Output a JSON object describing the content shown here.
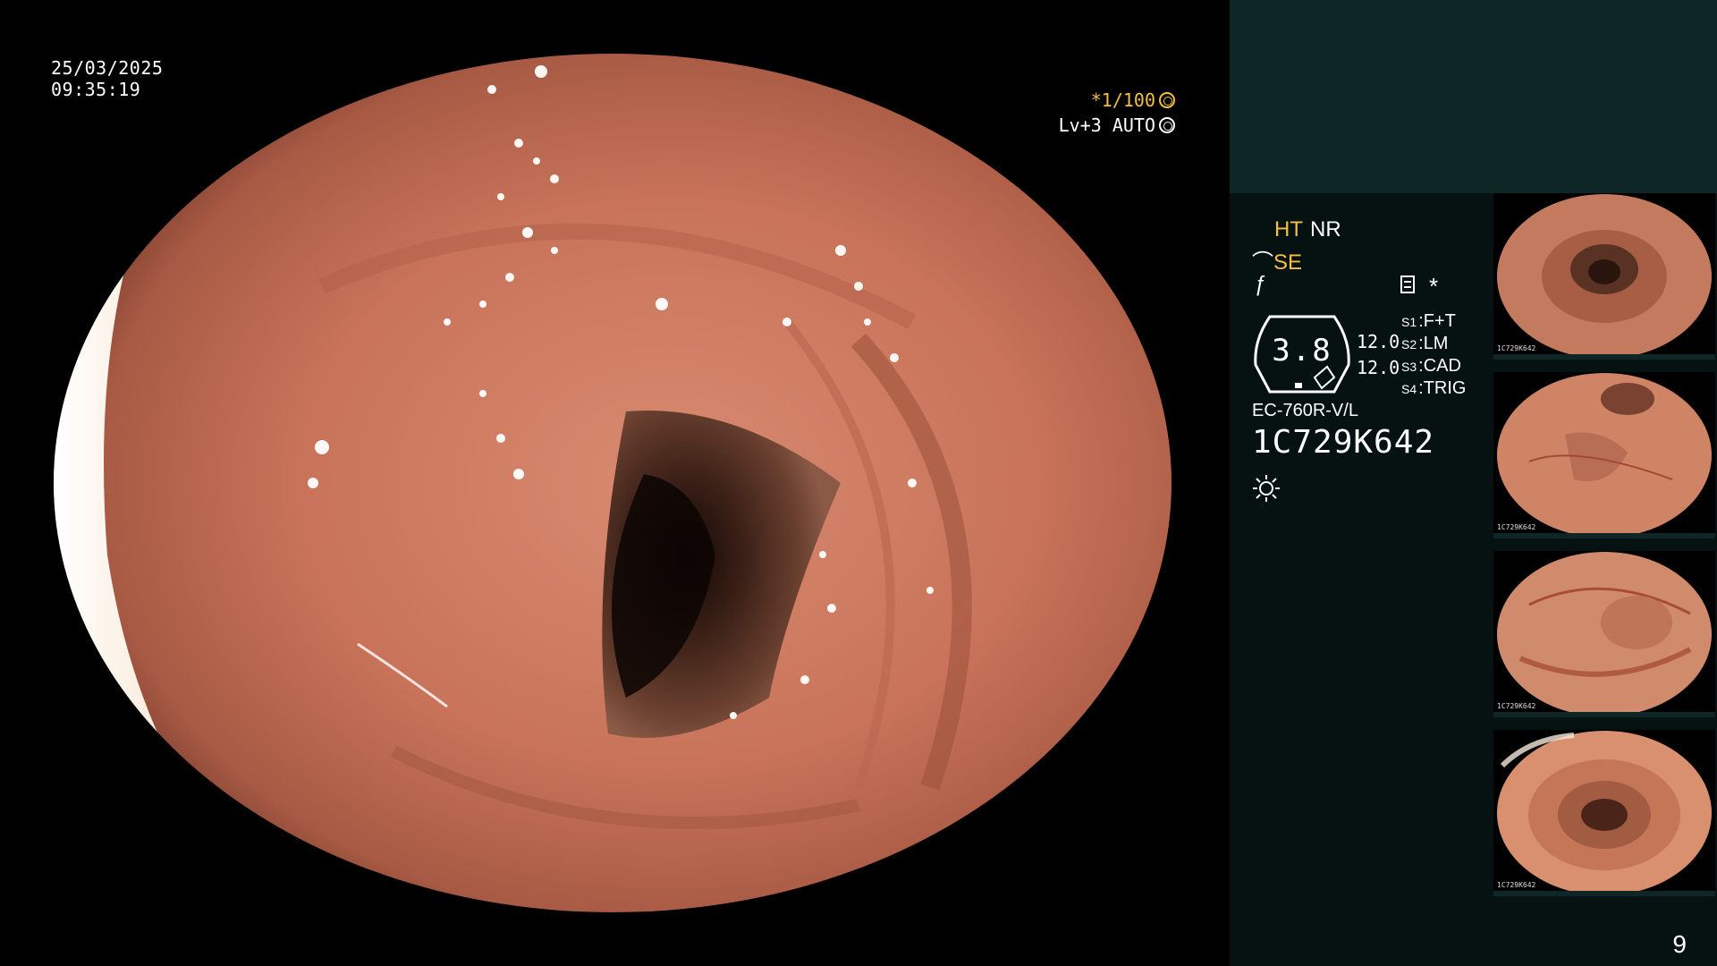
{
  "overlay": {
    "date": "25/03/2025",
    "time": "09:35:19",
    "shutter": "*1/100",
    "level": "Lv+3 AUTO"
  },
  "panel": {
    "ht_label": "HT",
    "nr_label": "NR",
    "se_label": "SE",
    "gauge_value": "3.8",
    "value_1": "12.0",
    "value_2": "12.0",
    "switches": [
      {
        "key": "S1",
        "value": "F+T"
      },
      {
        "key": "S2",
        "value": "LM"
      },
      {
        "key": "S3",
        "value": "CAD"
      },
      {
        "key": "S4",
        "value": "TRIG"
      }
    ],
    "scope_model": "EC-760R-V/L",
    "scope_serial": "1C729K642"
  },
  "thumbnails": [
    {
      "label": "1C729K642"
    },
    {
      "label": "1C729K642"
    },
    {
      "label": "1C729K642"
    },
    {
      "label": "1C729K642"
    }
  ],
  "page_number": "9",
  "colors": {
    "accent_yellow": "#f5c040",
    "panel_bg": "#061212",
    "panel_top_bg": "#0f2626",
    "mucosa": "#c8735a"
  },
  "icons": {
    "shutter_icon": "aperture-icon",
    "auto_icon": "auto-iris-icon",
    "light_icon": "light-source-icon",
    "mode_icon": "mode-list-icon"
  }
}
